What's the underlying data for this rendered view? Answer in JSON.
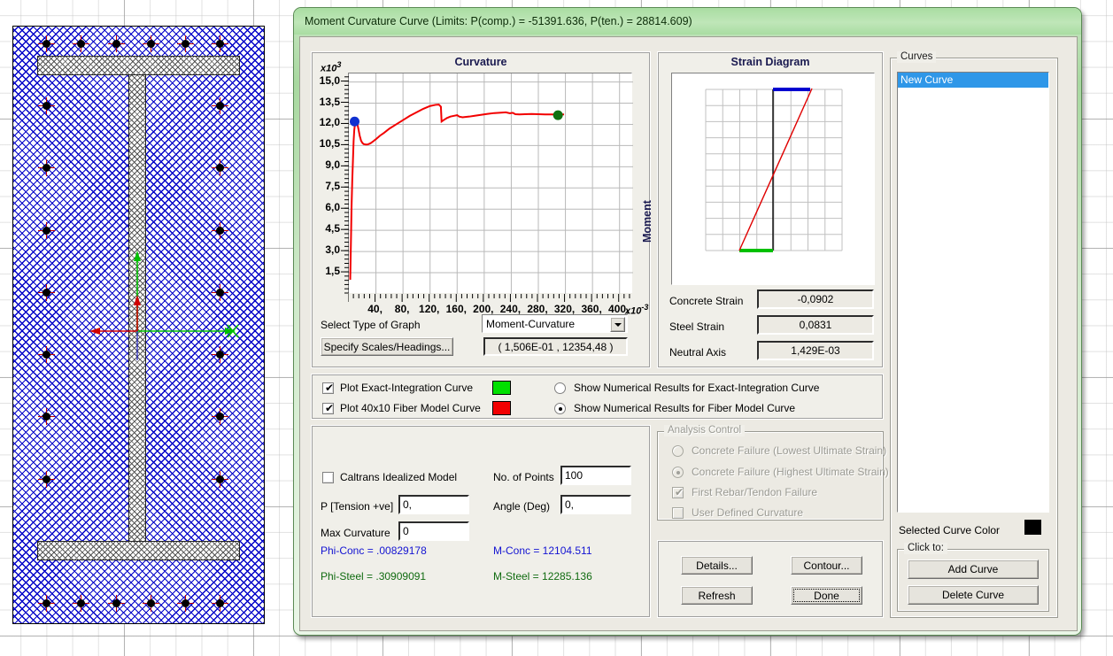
{
  "window": {
    "title": "Moment Curvature Curve (Limits:  P(comp.) = -51391.636, P(ten.) = 28814.609)"
  },
  "curvature_panel": {
    "title": "Curvature",
    "y_multiplier": "x10",
    "y_exponent": "3",
    "x_multiplier": "x10",
    "x_exponent": "-3",
    "moment_label": "Moment"
  },
  "graph_controls": {
    "select_type_label": "Select Type of Graph",
    "graph_type_value": "Moment-Curvature",
    "graph_type_options": [
      "Moment-Curvature"
    ],
    "specify_scales_button": "Specify Scales/Headings...",
    "coordinate_readout": "( 1,506E-01 , 12354,48 )"
  },
  "strain_panel": {
    "title": "Strain Diagram",
    "rows": [
      {
        "label": "Concrete Strain",
        "value": "-0,0902"
      },
      {
        "label": "Steel Strain",
        "value": "0,0831"
      },
      {
        "label": "Neutral Axis",
        "value": "1,429E-03"
      }
    ]
  },
  "plot_options": {
    "exact_integration": {
      "label": "Plot Exact-Integration Curve",
      "checked": true,
      "color": "#00e000"
    },
    "fiber_model": {
      "label": "Plot 40x10 Fiber Model Curve",
      "checked": true,
      "color": "#f20000"
    },
    "radio_exact": {
      "label": "Show Numerical Results for Exact-Integration Curve",
      "selected": false
    },
    "radio_fiber": {
      "label": "Show Numerical Results for Fiber Model Curve",
      "selected": true
    }
  },
  "inputs": {
    "caltrans": {
      "label": "Caltrans Idealized Model",
      "checked": false
    },
    "p_tension": {
      "label": "P [Tension +ve]",
      "value": "0,"
    },
    "max_curvature": {
      "label": "Max Curvature",
      "value": "0"
    },
    "no_of_points": {
      "label": "No. of Points",
      "value": "100"
    },
    "angle_deg": {
      "label": "Angle (Deg)",
      "value": "0,"
    }
  },
  "results": {
    "phi_conc": "Phi-Conc = .00829178",
    "phi_steel": "Phi-Steel = .30909091",
    "m_conc": "M-Conc = 12104.511",
    "m_steel": "M-Steel = 12285.136",
    "blue": "#1414d2",
    "green": "#106b10"
  },
  "analysis_control": {
    "title": "Analysis Control",
    "enabled": false,
    "items": [
      {
        "type": "radio",
        "label": "Concrete Failure (Lowest Ultimate Strain)",
        "selected": false
      },
      {
        "type": "radio",
        "label": "Concrete Failure (Highest Ultimate Strain)",
        "selected": true
      },
      {
        "type": "check",
        "label": "First Rebar/Tendon Failure",
        "checked": true
      },
      {
        "type": "check",
        "label": "User Defined Curvature",
        "checked": false
      }
    ]
  },
  "action_buttons": {
    "details": "Details...",
    "contour": "Contour...",
    "refresh": "Refresh",
    "done": "Done"
  },
  "curves_panel": {
    "title": "Curves",
    "items": [
      "New Curve"
    ],
    "selected_index": 0,
    "selected_curve_color_label": "Selected Curve Color",
    "selected_curve_color": "#000000",
    "click_to_title": "Click to:",
    "add_curve": "Add Curve",
    "delete_curve": "Delete Curve"
  },
  "chart_data": {
    "type": "line",
    "title": "Curvature",
    "xlabel": "Curvature",
    "ylabel": "Moment",
    "xlim": [
      0,
      420
    ],
    "ylim": [
      0,
      15.6
    ],
    "x_ticks": [
      40,
      80,
      120,
      160,
      200,
      240,
      280,
      320,
      360,
      400
    ],
    "y_ticks": [
      1.5,
      3.0,
      4.5,
      6.0,
      7.5,
      9.0,
      10.5,
      12.0,
      13.5,
      15.0
    ],
    "x_tick_labels": [
      "40,",
      "80,",
      "120,",
      "160,",
      "200,",
      "240,",
      "280,",
      "320,",
      "360,",
      "400,"
    ],
    "y_tick_labels": [
      "1,5",
      "3,0",
      "4,5",
      "6,0",
      "7,5",
      "9,0",
      "10,5",
      "12,0",
      "13,5",
      "15,0"
    ],
    "x_scale_note": "x10^-3",
    "y_scale_note": "x10^3",
    "grid": true,
    "series": [
      {
        "name": "40x10 Fiber Model Curve",
        "color": "#f20000",
        "x": [
          2,
          3,
          4,
          5,
          6,
          7,
          8,
          9,
          10,
          12,
          14,
          16,
          18,
          20,
          22,
          25,
          28,
          32,
          36,
          40,
          46,
          52,
          60,
          70,
          80,
          90,
          100,
          110,
          120,
          128,
          133,
          136,
          137,
          140,
          145,
          150,
          157,
          160,
          163,
          168,
          172,
          178,
          185,
          195,
          205,
          215,
          225,
          232,
          238,
          242,
          246,
          252,
          260,
          270,
          280,
          290,
          300,
          310,
          318
        ],
        "y": [
          1.0,
          3.5,
          6.2,
          8.0,
          9.4,
          10.8,
          11.6,
          12.0,
          12.22,
          12.15,
          11.7,
          11.2,
          10.85,
          10.68,
          10.6,
          10.57,
          10.58,
          10.66,
          10.8,
          10.95,
          11.2,
          11.4,
          11.7,
          12.0,
          12.3,
          12.6,
          12.85,
          13.1,
          13.3,
          13.38,
          13.4,
          13.25,
          12.2,
          12.3,
          12.45,
          12.55,
          12.62,
          12.65,
          12.55,
          12.5,
          12.52,
          12.55,
          12.6,
          12.67,
          12.74,
          12.8,
          12.83,
          12.85,
          12.78,
          12.82,
          12.72,
          12.7,
          12.72,
          12.73,
          12.72,
          12.7,
          12.7,
          12.7,
          12.7
        ]
      }
    ],
    "markers": [
      {
        "name": "start-marker",
        "x": 8.5,
        "y": 12.2,
        "color": "#1030d0"
      },
      {
        "name": "end-marker",
        "x": 309,
        "y": 12.65,
        "color": "#107010"
      }
    ]
  }
}
